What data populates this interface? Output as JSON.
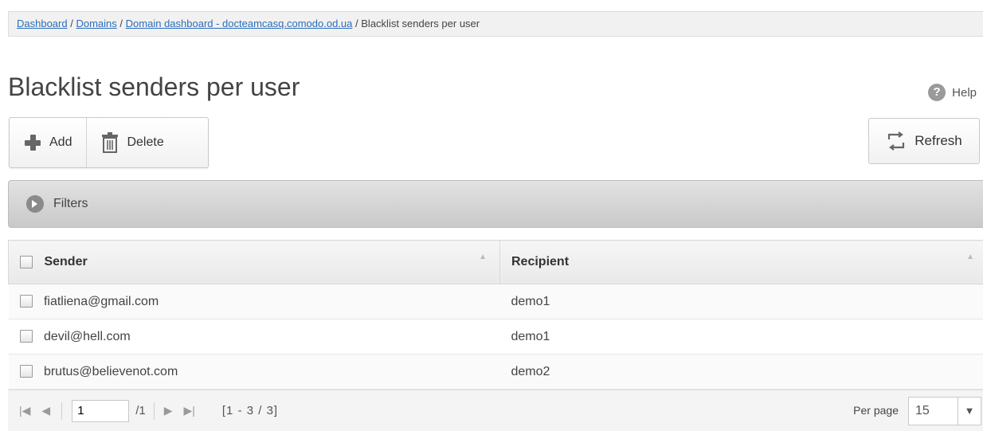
{
  "breadcrumb": {
    "items": [
      "Dashboard",
      "Domains",
      "Domain dashboard - docteamcasq.comodo.od.ua"
    ],
    "current": "Blacklist senders per user",
    "separator": "/"
  },
  "page": {
    "title": "Blacklist senders per user"
  },
  "help": {
    "label": "Help"
  },
  "toolbar": {
    "add_label": "Add",
    "delete_label": "Delete",
    "refresh_label": "Refresh"
  },
  "filters": {
    "label": "Filters"
  },
  "table": {
    "columns": [
      "Sender",
      "Recipient"
    ],
    "rows": [
      {
        "sender": "fiatliena@gmail.com",
        "recipient": "demo1"
      },
      {
        "sender": "devil@hell.com",
        "recipient": "demo1"
      },
      {
        "sender": "brutus@believenot.com",
        "recipient": "demo2"
      }
    ]
  },
  "pagination": {
    "current_page": "1",
    "total_pages": "/1",
    "range": "[1 - 3 / 3]",
    "per_page_label": "Per page",
    "per_page_value": "15"
  },
  "colors": {
    "link": "#2a6ebb",
    "filter_bar": "#cfcfcf",
    "header_bg": "#eeeeee"
  },
  "icons": [
    "plus-icon",
    "trash-icon",
    "refresh-icon",
    "help-icon",
    "chevron-right-icon",
    "first-page-icon",
    "prev-page-icon",
    "next-page-icon",
    "last-page-icon",
    "dropdown-arrow-icon"
  ]
}
